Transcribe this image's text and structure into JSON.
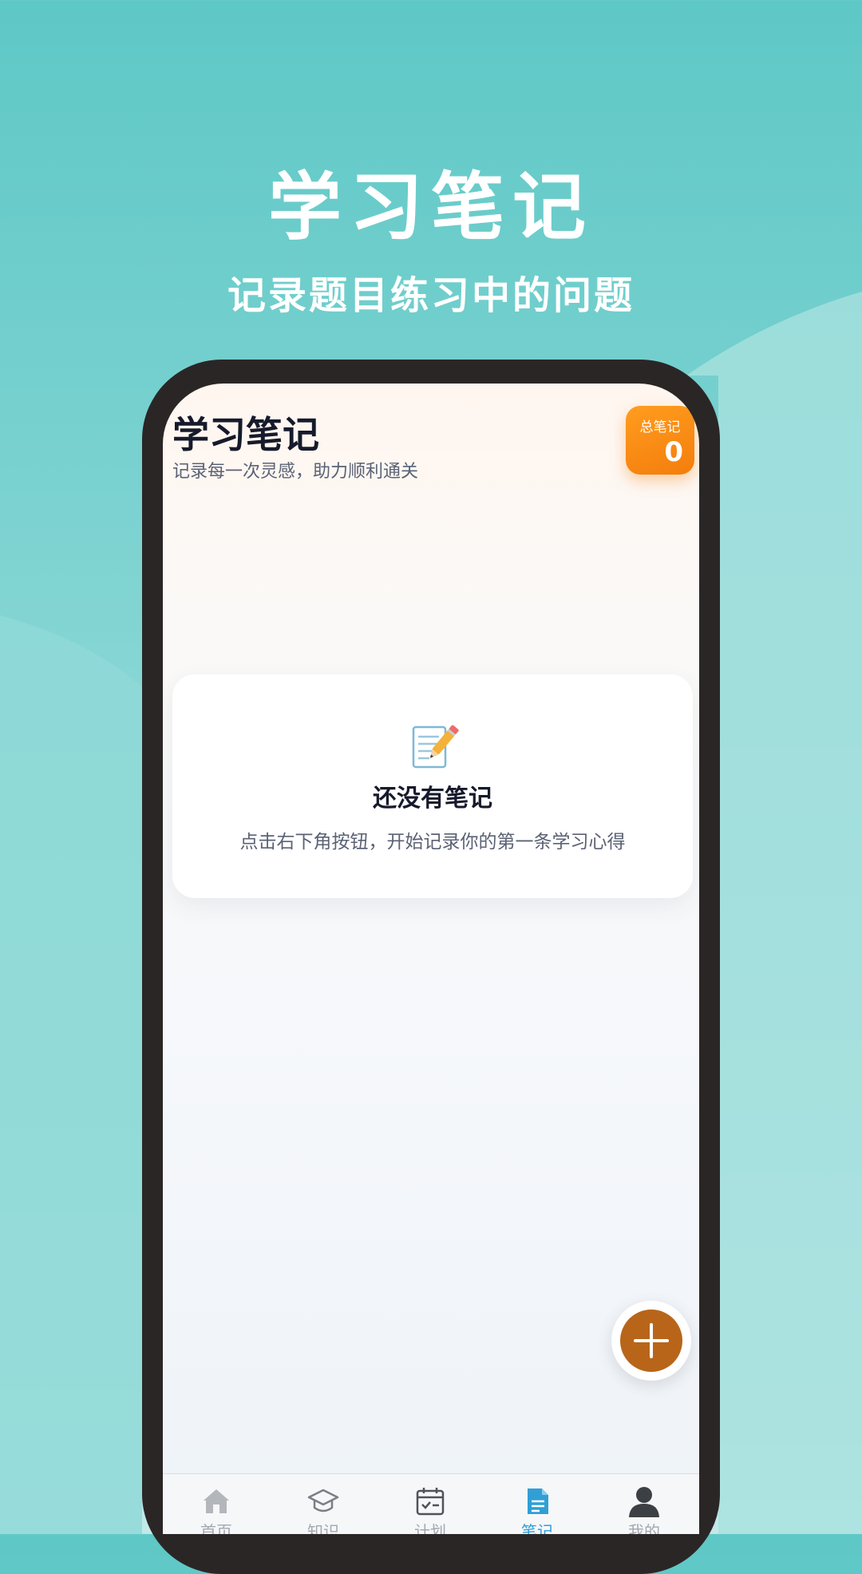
{
  "promo": {
    "title": "学习笔记",
    "subtitle": "记录题目练习中的问题"
  },
  "header": {
    "title": "学习笔记",
    "subtitle": "记录每一次灵感，助力顺利通关"
  },
  "stats": {
    "label": "总笔记",
    "value": "0"
  },
  "empty_state": {
    "icon": "memo-icon",
    "title": "还没有笔记",
    "description": "点击右下角按钮，开始记录你的第一条学习心得"
  },
  "fab": {
    "icon": "plus-icon"
  },
  "tabbar": {
    "tabs": [
      {
        "label": "首页",
        "icon": "home-icon",
        "active": false
      },
      {
        "label": "知识",
        "icon": "graduation-cap-icon",
        "active": false
      },
      {
        "label": "计划",
        "icon": "calendar-check-icon",
        "active": false
      },
      {
        "label": "笔记",
        "icon": "document-icon",
        "active": true
      },
      {
        "label": "我的",
        "icon": "user-icon",
        "active": false
      }
    ]
  },
  "colors": {
    "background": "#5ec8c6",
    "accent_orange": "#f47d0c",
    "fab_brown": "#b8651a",
    "active_tab": "#2f9fd6"
  }
}
